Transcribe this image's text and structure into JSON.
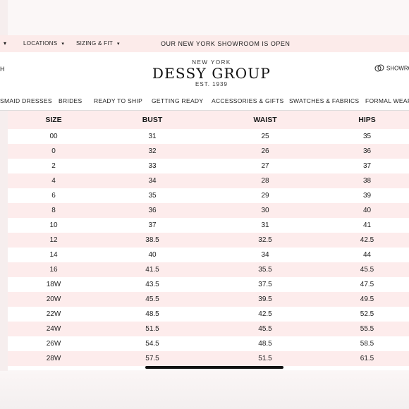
{
  "topbar": {
    "first_caret": "▾",
    "locations": "LOCATIONS",
    "sizing": "SIZING & FIT",
    "caret": "▾",
    "promo": "OUR NEW YORK SHOWROOM IS OPEN"
  },
  "header": {
    "left_cutoff": "H",
    "logo_top": "NEW YORK",
    "logo_brand": "DESSY GROUP",
    "logo_est": "EST. 1939",
    "showroom": "SHOWRO"
  },
  "nav": [
    "SMAID DRESSES",
    "BRIDES",
    "READY TO SHIP",
    "GETTING READY",
    "ACCESSORIES & GIFTS",
    "SWATCHES & FABRICS",
    "FORMAL WEAR"
  ],
  "table": {
    "headers": [
      "SIZE",
      "BUST",
      "WAIST",
      "HIPS"
    ],
    "rows": [
      [
        "00",
        "31",
        "25",
        "35"
      ],
      [
        "0",
        "32",
        "26",
        "36"
      ],
      [
        "2",
        "33",
        "27",
        "37"
      ],
      [
        "4",
        "34",
        "28",
        "38"
      ],
      [
        "6",
        "35",
        "29",
        "39"
      ],
      [
        "8",
        "36",
        "30",
        "40"
      ],
      [
        "10",
        "37",
        "31",
        "41"
      ],
      [
        "12",
        "38.5",
        "32.5",
        "42.5"
      ],
      [
        "14",
        "40",
        "34",
        "44"
      ],
      [
        "16",
        "41.5",
        "35.5",
        "45.5"
      ],
      [
        "18W",
        "43.5",
        "37.5",
        "47.5"
      ],
      [
        "20W",
        "45.5",
        "39.5",
        "49.5"
      ],
      [
        "22W",
        "48.5",
        "42.5",
        "52.5"
      ],
      [
        "24W",
        "51.5",
        "45.5",
        "55.5"
      ],
      [
        "26W",
        "54.5",
        "48.5",
        "58.5"
      ],
      [
        "28W",
        "57.5",
        "51.5",
        "61.5"
      ]
    ]
  },
  "colors": {
    "accent_pink": "#fdecec",
    "text": "#1a1a1a"
  },
  "icons": {
    "rings": "rings-icon",
    "caret": "chevron-down-icon"
  }
}
